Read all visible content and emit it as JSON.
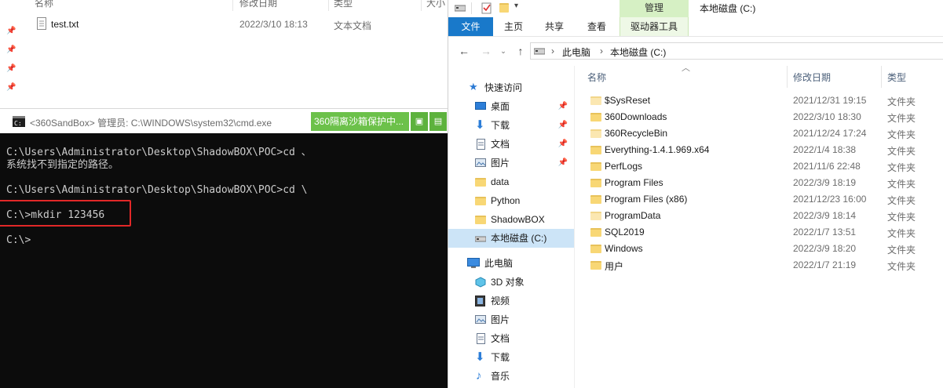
{
  "bg_explorer": {
    "headers": [
      "名称",
      "修改日期",
      "类型",
      "大小"
    ],
    "file": {
      "name": "test.txt",
      "date": "2022/3/10 18:13",
      "type": "文本文档"
    }
  },
  "cmd": {
    "title": "<360SandBox> 管理员: C:\\WINDOWS\\system32\\cmd.exe",
    "badge": "360隔离沙箱保护中...",
    "lines": [
      "C:\\Users\\Administrator\\Desktop\\ShadowBOX\\POC>cd 、",
      "系统找不到指定的路径。",
      "",
      "C:\\Users\\Administrator\\Desktop\\ShadowBOX\\POC>cd \\",
      "",
      "C:\\>mkdir 123456",
      "",
      "C:\\>"
    ],
    "highlight_color": "#e22828"
  },
  "explorer": {
    "title": "本地磁盘 (C:)",
    "manage_tab": "管理",
    "ribbon_tabs": [
      "文件",
      "主页",
      "共享",
      "查看",
      "驱动器工具"
    ],
    "breadcrumb": [
      "此电脑",
      "本地磁盘 (C:)"
    ],
    "columns": {
      "name": "名称",
      "date": "修改日期",
      "type": "类型"
    },
    "tree": [
      {
        "label": "快速访问",
        "icon": "star-icon"
      },
      {
        "label": "桌面",
        "icon": "desktop-icon",
        "pinned": true
      },
      {
        "label": "下载",
        "icon": "download-icon",
        "pinned": true
      },
      {
        "label": "文档",
        "icon": "document-icon",
        "pinned": true
      },
      {
        "label": "图片",
        "icon": "picture-icon",
        "pinned": true
      },
      {
        "label": "data",
        "icon": "folder-icon"
      },
      {
        "label": "Python",
        "icon": "folder-icon"
      },
      {
        "label": "ShadowBOX",
        "icon": "folder-icon"
      },
      {
        "label": "本地磁盘 (C:)",
        "icon": "drive-icon",
        "selected": true
      },
      {
        "label": "此电脑",
        "icon": "pc-icon"
      },
      {
        "label": "3D 对象",
        "icon": "3d-icon"
      },
      {
        "label": "视频",
        "icon": "video-icon"
      },
      {
        "label": "图片",
        "icon": "picture-icon"
      },
      {
        "label": "文档",
        "icon": "document-icon"
      },
      {
        "label": "下载",
        "icon": "download-icon"
      },
      {
        "label": "音乐",
        "icon": "music-icon"
      }
    ],
    "files": [
      {
        "name": "$SysReset",
        "date": "2021/12/31 19:15",
        "type": "文件夹",
        "pale": true
      },
      {
        "name": "360Downloads",
        "date": "2022/3/10 18:30",
        "type": "文件夹"
      },
      {
        "name": "360RecycleBin",
        "date": "2021/12/24 17:24",
        "type": "文件夹",
        "pale": true
      },
      {
        "name": "Everything-1.4.1.969.x64",
        "date": "2022/1/4 18:38",
        "type": "文件夹"
      },
      {
        "name": "PerfLogs",
        "date": "2021/11/6 22:48",
        "type": "文件夹"
      },
      {
        "name": "Program Files",
        "date": "2022/3/9 18:19",
        "type": "文件夹"
      },
      {
        "name": "Program Files (x86)",
        "date": "2021/12/23 16:00",
        "type": "文件夹"
      },
      {
        "name": "ProgramData",
        "date": "2022/3/9 18:14",
        "type": "文件夹",
        "pale": true
      },
      {
        "name": "SQL2019",
        "date": "2022/1/7 13:51",
        "type": "文件夹"
      },
      {
        "name": "Windows",
        "date": "2022/3/9 18:20",
        "type": "文件夹"
      },
      {
        "name": "用户",
        "date": "2022/1/7 21:19",
        "type": "文件夹"
      }
    ]
  }
}
